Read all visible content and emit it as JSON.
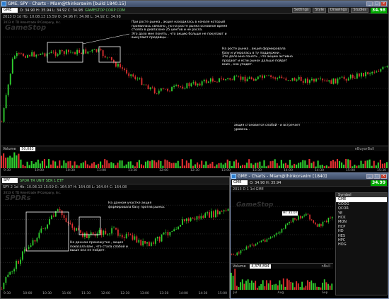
{
  "top": {
    "title": "GME, SPY - Charts - Mlam@thinkorswim [build 1840.15]",
    "menu": [
      "Charts"
    ],
    "symbol": "GME",
    "quote": "O: 34.90 H: 35.94 L: 34.92 C: 34.98",
    "link": "GAMESTOP CORP COM",
    "buttons": {
      "settings": "Settings",
      "style": "Style",
      "drawings": "Drawings",
      "studies": "Studies"
    },
    "price": "34.98",
    "subbar": "2013 D 1d  Hb: 10.08.13 15:59  O: 34.96  H: 34.98  L: 34.92  C: 34.98",
    "watermark": "GameStop",
    "copyright": "2013 © TD Ameritrade IP Company, Inc.",
    "notes": {
      "n1": "При росте рынка , акция находилась в начале который\nпроявилась связано , но на росте рынка основное время\nстояла в диапазоне 25 центов и не росла.\nЭто дало мне понять , что акцию больше не покупают и\nвыкупают продавцы .",
      "n2": "На росте рынка , акция формировала\nбазу и упиралась в ту поддержки .\nЭто дало мне понять , что акцию активно\nпродают и если рынок дальше пойдет\nвниз , она упадет.",
      "n3": "акция становится слабой - и встречает\nуровень ."
    },
    "volume_label": "Volume",
    "volume_value": "50,083",
    "volume_right": "nBuyorBull",
    "times": [
      "9:30",
      "10:00",
      "10:30",
      "11:00",
      "11:30",
      "12:00",
      "12:30",
      "13:00",
      "13:30",
      "14:00",
      "14:30",
      "15:00",
      "15:30"
    ]
  },
  "bottom": {
    "symbol": "SPY",
    "quote": "SPDR TR UNIT SER 1 ETF",
    "subbar": "SPY 2 1d  Hb: 10.08.13 15:59  O: 164.07  H: 164.08  L: 164.04  C: 164.08",
    "watermark": "SPDRs",
    "copyright": "2013 © TD Ameritrade IP Company, Inc.",
    "notes": {
      "n1": "На данном промежутке , акция\nпоказала вам , что стала слабой и\nвыше она не пойдет.",
      "n2": "На данном участке акция\nформировала базу против рынка."
    },
    "times": [
      "9:30",
      "10:00",
      "10:30",
      "11:00",
      "11:30",
      "12:00",
      "12:30",
      "13:00",
      "13:30",
      "14:00",
      "14:30",
      "15:00"
    ]
  },
  "popup": {
    "title": "GME - Charts - Mlam@thinkorswim [1840]",
    "symbol": "GME",
    "quote": "O: 34.90 H: 35.94",
    "price": "34.99",
    "subbar": "2013 D 1 1d  GME",
    "watermark": "GameStop",
    "hi_label": "Hi: 35.07",
    "volume_label": "Volume",
    "volume_value": "4,378,894",
    "volume_right": "nBull",
    "times": [
      "Jul",
      "Aug",
      "Sep"
    ]
  },
  "watchlist": {
    "header": "Symbol",
    "items": [
      "GME",
      "GOOG",
      "QCOR",
      "YE",
      "HCK",
      "MON",
      "HCP",
      "HD",
      "HES",
      "HPC",
      "HOG"
    ]
  },
  "colors": {
    "up": "#2fd02f",
    "down": "#e03030",
    "accent": "#3d4b66",
    "price": "#00aa00"
  }
}
